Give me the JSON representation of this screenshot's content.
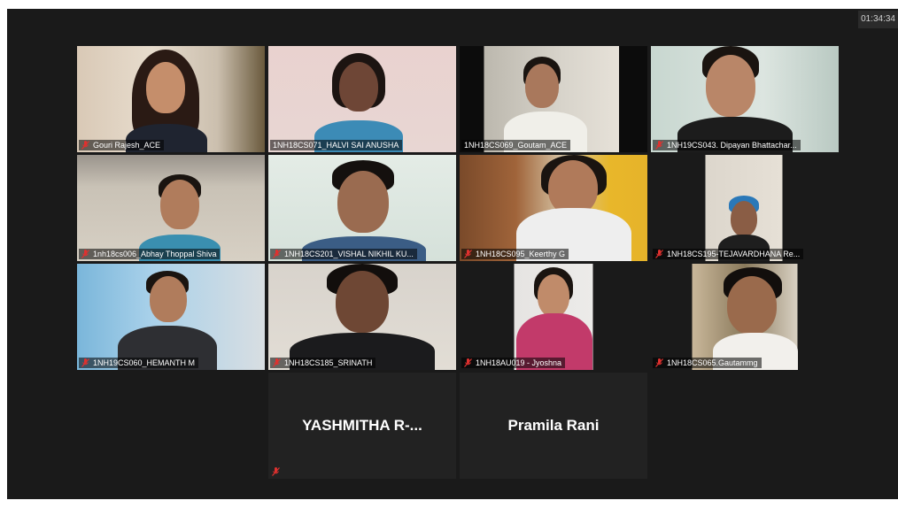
{
  "timer": "01:34:34",
  "participants": [
    {
      "name": "Gouri Rajesh_ACE",
      "muted": true
    },
    {
      "name": "1NH18CS071_HALVI SAI ANUSHA",
      "muted": false
    },
    {
      "name": "1NH18CS069_Goutam_ACE",
      "muted": false
    },
    {
      "name": "1NH19CS043. Dipayan Bhattachar...",
      "muted": true
    },
    {
      "name": "1nh18cs006_Abhay Thoppal Shiva",
      "muted": true
    },
    {
      "name": "1NH18CS201_VISHAL NIKHIL KU...",
      "muted": true
    },
    {
      "name": "1NH18CS095_Keerthy G",
      "muted": true
    },
    {
      "name": "1NH18CS195-TEJAVARDHANA Re...",
      "muted": true
    },
    {
      "name": "1NH19CS060_HEMANTH M",
      "muted": true
    },
    {
      "name": "1NH18CS185_SRINATH",
      "muted": true
    },
    {
      "name": "1NH18AU019 - Jyoshna",
      "muted": true
    },
    {
      "name": "1NH18CS065.Gautammg",
      "muted": true
    },
    {
      "name": "YASHMITHA  R-...",
      "muted": true
    },
    {
      "name": "Pramila Rani",
      "muted": false
    }
  ],
  "colors": {
    "active_border": "#d6e35a",
    "muted_icon": "#e0312f",
    "background": "#1a1a1a"
  }
}
